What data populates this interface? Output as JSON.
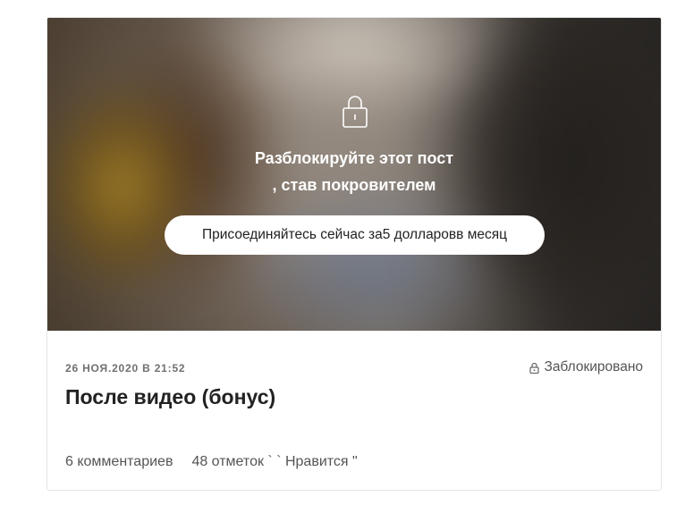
{
  "post": {
    "unlock_line1": "Разблокируйте этот пост",
    "unlock_line2": ", став покровителем",
    "join_button_label": "Присоединяйтесь сейчас за5 долларовв месяц",
    "date": "26 НОЯ.2020 В 21:52",
    "locked_label": "Заблокировано",
    "title": "После видео (бонус)",
    "comments": "6 комментариев",
    "likes": "48 отметок ` ` Нравится \""
  },
  "icons": {
    "big_lock": "lock-icon",
    "small_lock": "lock-icon"
  },
  "colors": {
    "overlay_text": "#ffffff",
    "button_bg": "#ffffff",
    "title_text": "#222222",
    "meta_text": "#555555"
  }
}
